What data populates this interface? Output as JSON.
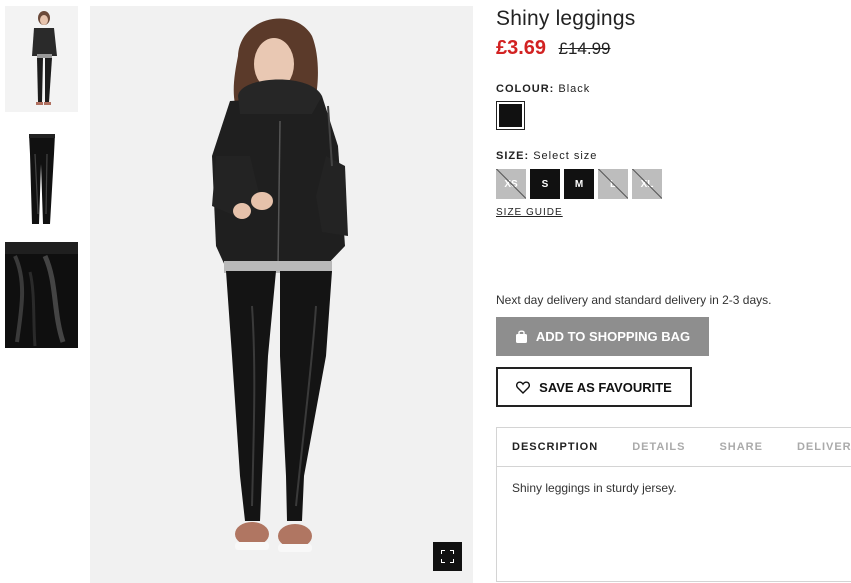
{
  "product": {
    "title": "Shiny leggings",
    "price_sale": "£3.69",
    "price_original": "£14.99"
  },
  "colour": {
    "label": "COLOUR:",
    "value": "Black",
    "swatch_color": "#111111"
  },
  "size": {
    "label": "SIZE:",
    "prompt": "Select size",
    "options": [
      {
        "label": "XS",
        "available": false
      },
      {
        "label": "S",
        "available": true
      },
      {
        "label": "M",
        "available": true
      },
      {
        "label": "L",
        "available": false
      },
      {
        "label": "XL",
        "available": false
      }
    ],
    "guide_label": "SIZE GUIDE"
  },
  "delivery_note": "Next day delivery and standard delivery in 2-3 days.",
  "buttons": {
    "add_to_bag": "ADD TO SHOPPING BAG",
    "save_favourite": "SAVE AS FAVOURITE"
  },
  "tabs": [
    {
      "label": "DESCRIPTION",
      "active": true
    },
    {
      "label": "DETAILS",
      "active": false
    },
    {
      "label": "SHARE",
      "active": false
    },
    {
      "label": "DELIVERY",
      "active": false
    }
  ],
  "description_text": "Shiny leggings in sturdy jersey.",
  "colors": {
    "sale_price": "#d22222",
    "add_button": "#8e8e8e",
    "unavailable_size": "#bdbdbd"
  },
  "icons": {
    "add_button": "shopping-bag-icon",
    "fav_button": "heart-icon",
    "fullscreen": "fullscreen-icon"
  }
}
